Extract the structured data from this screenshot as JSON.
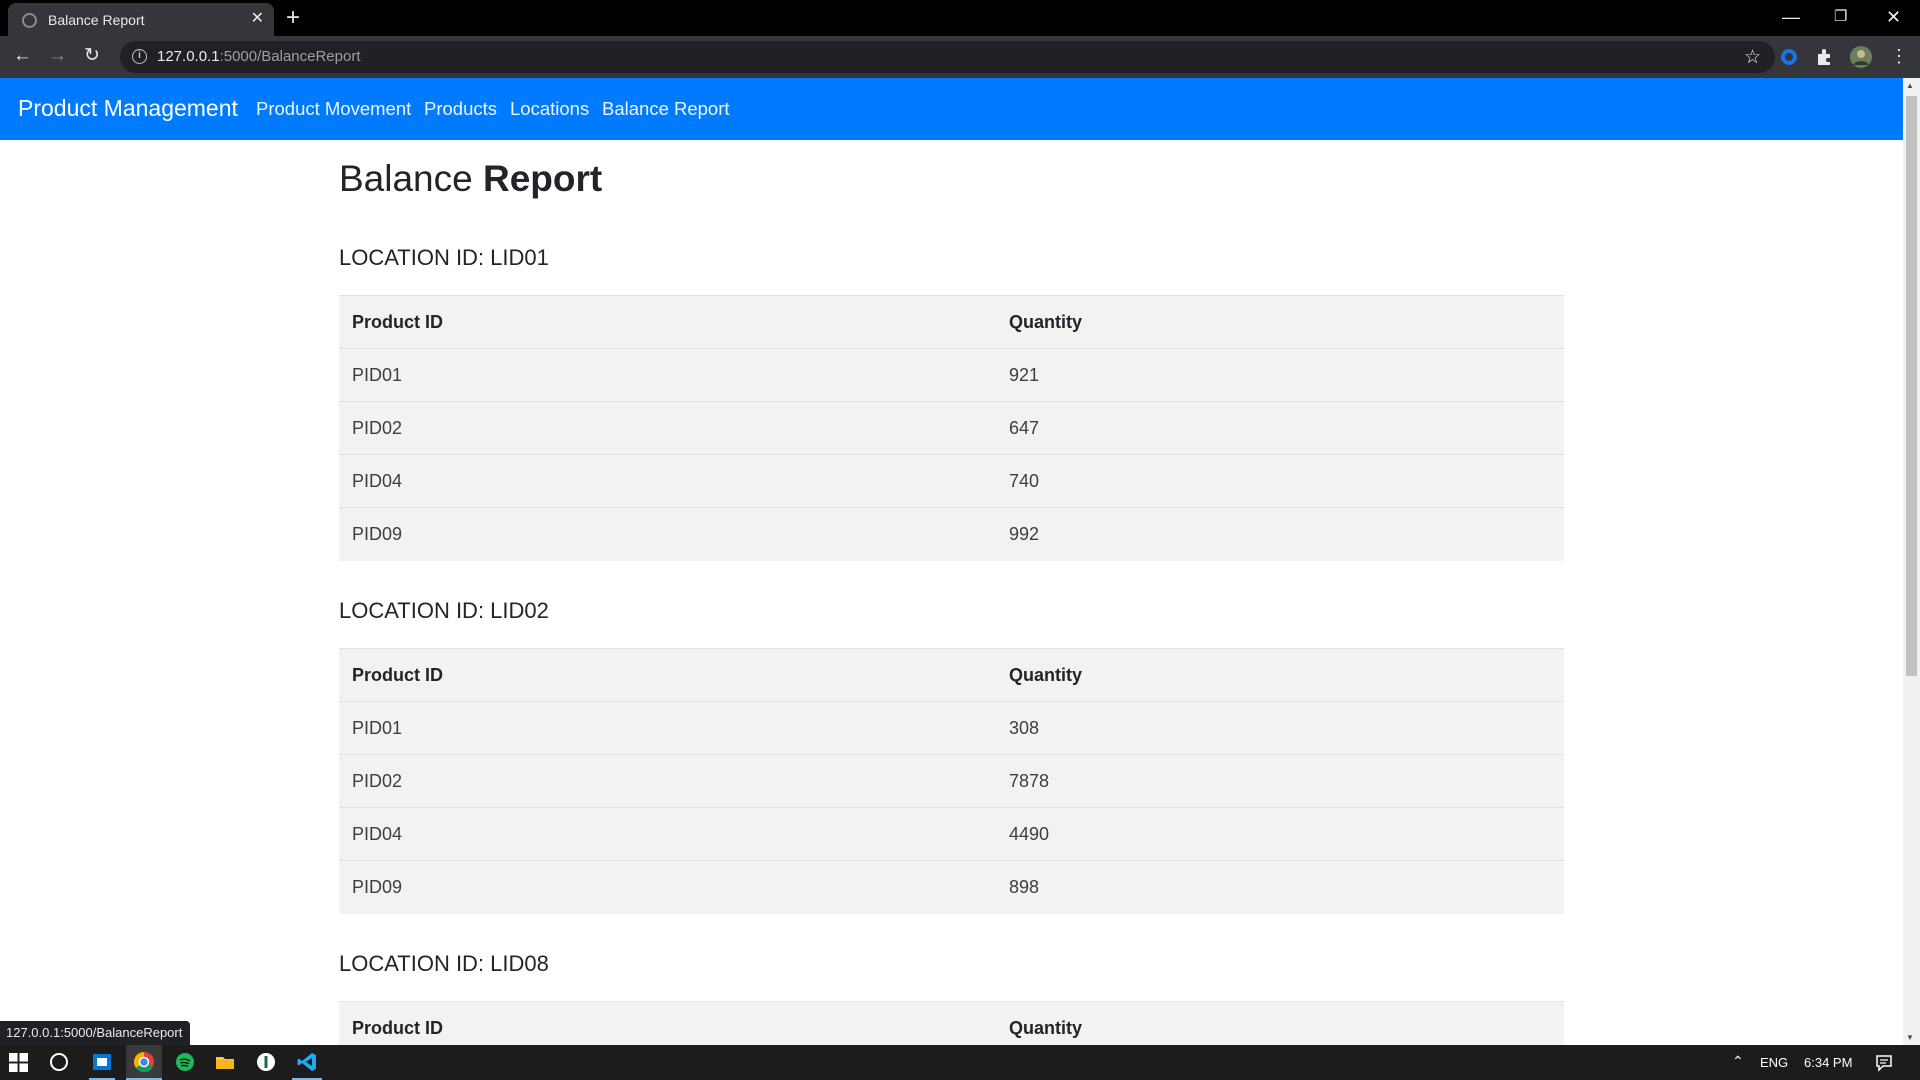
{
  "browser": {
    "tab_title": "Balance Report",
    "new_tab_icon": "+",
    "url_host": "127.0.0.1",
    "url_rest": ":5000/BalanceReport",
    "status_url": "127.0.0.1:5000/BalanceReport"
  },
  "navbar": {
    "brand": "Product Management",
    "links": [
      "Product Movement",
      "Products",
      "Locations",
      "Balance Report"
    ],
    "color": "#007bff"
  },
  "page": {
    "title_light": "Balance",
    "title_bold": "Report",
    "sections": [
      {
        "heading": "LOCATION ID: LID01",
        "headers": [
          "Product ID",
          "Quantity"
        ],
        "rows": [
          [
            "PID01",
            "921"
          ],
          [
            "PID02",
            "647"
          ],
          [
            "PID04",
            "740"
          ],
          [
            "PID09",
            "992"
          ]
        ]
      },
      {
        "heading": "LOCATION ID: LID02",
        "headers": [
          "Product ID",
          "Quantity"
        ],
        "rows": [
          [
            "PID01",
            "308"
          ],
          [
            "PID02",
            "7878"
          ],
          [
            "PID04",
            "4490"
          ],
          [
            "PID09",
            "898"
          ]
        ]
      },
      {
        "heading": "LOCATION ID: LID08",
        "headers": [
          "Product ID",
          "Quantity"
        ],
        "rows": []
      }
    ]
  },
  "taskbar": {
    "language": "ENG",
    "time": "6:34 PM"
  }
}
